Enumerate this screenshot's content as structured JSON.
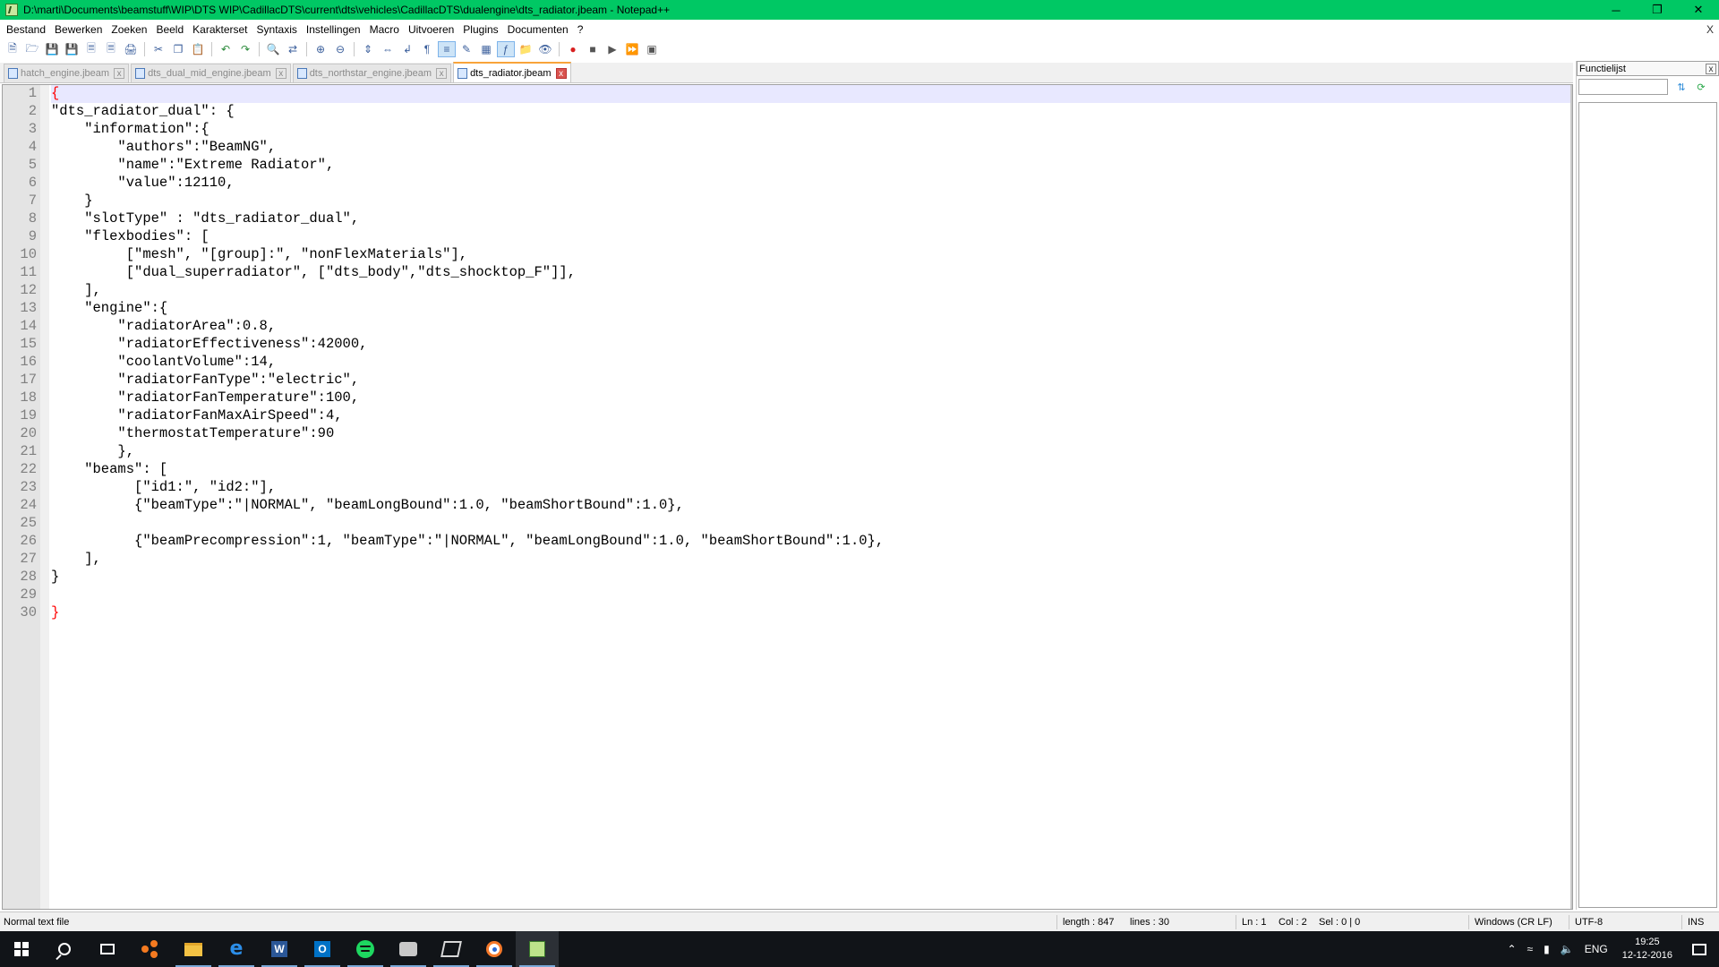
{
  "window": {
    "title": "D:\\marti\\Documents\\beamstuff\\WIP\\DTS WIP\\CadillacDTS\\current\\dts\\vehicles\\CadillacDTS\\dualengine\\dts_radiator.jbeam - Notepad++",
    "controls": {
      "minimize": "─",
      "restore": "❐",
      "close": "✕"
    }
  },
  "menubar": {
    "items": [
      "Bestand",
      "Bewerken",
      "Zoeken",
      "Beeld",
      "Karakterset",
      "Syntaxis",
      "Instellingen",
      "Macro",
      "Uitvoeren",
      "Plugins",
      "Documenten",
      "?"
    ],
    "close_label": "X"
  },
  "tabs": [
    {
      "label": "hatch_engine.jbeam",
      "active": false
    },
    {
      "label": "dts_dual_mid_engine.jbeam",
      "active": false
    },
    {
      "label": "dts_northstar_engine.jbeam",
      "active": false
    },
    {
      "label": "dts_radiator.jbeam",
      "active": true
    }
  ],
  "editor": {
    "line_numbers": [
      "1",
      "2",
      "3",
      "4",
      "5",
      "6",
      "7",
      "8",
      "9",
      "10",
      "11",
      "12",
      "13",
      "14",
      "15",
      "16",
      "17",
      "18",
      "19",
      "20",
      "21",
      "22",
      "23",
      "24",
      "25",
      "26",
      "27",
      "28",
      "29",
      "30"
    ],
    "lines": [
      "{",
      "\"dts_radiator_dual\": {",
      "    \"information\":{",
      "        \"authors\":\"BeamNG\",",
      "        \"name\":\"Extreme Radiator\",",
      "        \"value\":12110,",
      "    }",
      "    \"slotType\" : \"dts_radiator_dual\",",
      "    \"flexbodies\": [",
      "         [\"mesh\", \"[group]:\", \"nonFlexMaterials\"],",
      "         [\"dual_superradiator\", [\"dts_body\",\"dts_shocktop_F\"]],",
      "    ],",
      "    \"engine\":{",
      "        \"radiatorArea\":0.8,",
      "        \"radiatorEffectiveness\":42000,",
      "        \"coolantVolume\":14,",
      "        \"radiatorFanType\":\"electric\",",
      "        \"radiatorFanTemperature\":100,",
      "        \"radiatorFanMaxAirSpeed\":4,",
      "        \"thermostatTemperature\":90",
      "        },",
      "    \"beams\": [",
      "          [\"id1:\", \"id2:\"],",
      "          {\"beamType\":\"|NORMAL\", \"beamLongBound\":1.0, \"beamShortBound\":1.0},",
      "",
      "          {\"beamPrecompression\":1, \"beamType\":\"|NORMAL\", \"beamLongBound\":1.0, \"beamShortBound\":1.0},",
      "    ],",
      "}",
      "",
      "}"
    ]
  },
  "function_list": {
    "title": "Functielijst",
    "close_label": "x",
    "search_value": "",
    "sort_icon": "sort-az-icon",
    "reload_icon": "reload-icon"
  },
  "statusbar": {
    "file_type": "Normal text file",
    "length": "length : 847",
    "lines": "lines : 30",
    "ln": "Ln : 1",
    "col": "Col : 2",
    "sel": "Sel : 0 | 0",
    "eol": "Windows (CR LF)",
    "encoding": "UTF-8",
    "mode": "INS"
  },
  "taskbar": {
    "tray": {
      "language": "ENG",
      "time": "19:25",
      "date": "12-12-2016"
    }
  },
  "colors": {
    "titlebar": "#00c864",
    "brace": "#ff0000",
    "current_line": "#e8e8ff",
    "active_tab_accent": "#f9a43a"
  }
}
